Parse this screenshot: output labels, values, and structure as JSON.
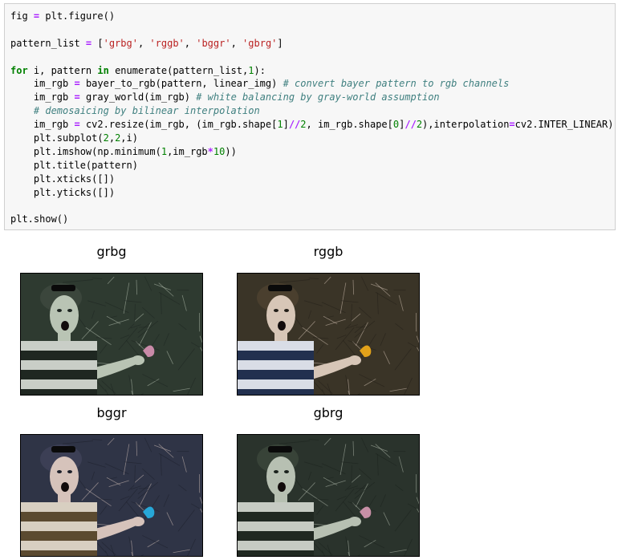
{
  "code_cell": {
    "lines": [
      [
        {
          "t": "plain",
          "v": "fig "
        },
        {
          "t": "op",
          "v": "="
        },
        {
          "t": "plain",
          "v": " plt.figure()"
        }
      ],
      [],
      [
        {
          "t": "plain",
          "v": "pattern_list "
        },
        {
          "t": "op",
          "v": "="
        },
        {
          "t": "plain",
          "v": " ["
        },
        {
          "t": "str",
          "v": "'grbg'"
        },
        {
          "t": "plain",
          "v": ", "
        },
        {
          "t": "str",
          "v": "'rggb'"
        },
        {
          "t": "plain",
          "v": ", "
        },
        {
          "t": "str",
          "v": "'bggr'"
        },
        {
          "t": "plain",
          "v": ", "
        },
        {
          "t": "str",
          "v": "'gbrg'"
        },
        {
          "t": "plain",
          "v": "]"
        }
      ],
      [],
      [
        {
          "t": "kw",
          "v": "for"
        },
        {
          "t": "plain",
          "v": " i, pattern "
        },
        {
          "t": "kw",
          "v": "in"
        },
        {
          "t": "plain",
          "v": " enumerate(pattern_list,"
        },
        {
          "t": "num",
          "v": "1"
        },
        {
          "t": "plain",
          "v": "):"
        }
      ],
      [
        {
          "t": "plain",
          "v": "    im_rgb "
        },
        {
          "t": "op",
          "v": "="
        },
        {
          "t": "plain",
          "v": " bayer_to_rgb(pattern, linear_img) "
        },
        {
          "t": "cm",
          "v": "# convert bayer pattern to rgb channels"
        }
      ],
      [
        {
          "t": "plain",
          "v": "    im_rgb "
        },
        {
          "t": "op",
          "v": "="
        },
        {
          "t": "plain",
          "v": " gray_world(im_rgb) "
        },
        {
          "t": "cm",
          "v": "# white balancing by gray-world assumption"
        }
      ],
      [
        {
          "t": "plain",
          "v": "    "
        },
        {
          "t": "cm",
          "v": "# demosaicing by bilinear interpolation"
        }
      ],
      [
        {
          "t": "plain",
          "v": "    im_rgb "
        },
        {
          "t": "op",
          "v": "="
        },
        {
          "t": "plain",
          "v": " cv2.resize(im_rgb, (im_rgb.shape["
        },
        {
          "t": "num",
          "v": "1"
        },
        {
          "t": "plain",
          "v": "]"
        },
        {
          "t": "op",
          "v": "//"
        },
        {
          "t": "num",
          "v": "2"
        },
        {
          "t": "plain",
          "v": ", im_rgb.shape["
        },
        {
          "t": "num",
          "v": "0"
        },
        {
          "t": "plain",
          "v": "]"
        },
        {
          "t": "op",
          "v": "//"
        },
        {
          "t": "num",
          "v": "2"
        },
        {
          "t": "plain",
          "v": "),interpolation"
        },
        {
          "t": "op",
          "v": "="
        },
        {
          "t": "plain",
          "v": "cv2.INTER_LINEAR)"
        }
      ],
      [
        {
          "t": "plain",
          "v": "    plt.subplot("
        },
        {
          "t": "num",
          "v": "2"
        },
        {
          "t": "plain",
          "v": ","
        },
        {
          "t": "num",
          "v": "2"
        },
        {
          "t": "plain",
          "v": ",i)"
        }
      ],
      [
        {
          "t": "plain",
          "v": "    plt.imshow(np.minimum("
        },
        {
          "t": "num",
          "v": "1"
        },
        {
          "t": "plain",
          "v": ",im_rgb"
        },
        {
          "t": "op",
          "v": "*"
        },
        {
          "t": "num",
          "v": "10"
        },
        {
          "t": "plain",
          "v": "))"
        }
      ],
      [
        {
          "t": "plain",
          "v": "    plt.title(pattern)"
        }
      ],
      [
        {
          "t": "plain",
          "v": "    plt.xticks([])"
        }
      ],
      [
        {
          "t": "plain",
          "v": "    plt.yticks([])"
        }
      ],
      [],
      [
        {
          "t": "plain",
          "v": "plt.show()"
        }
      ]
    ]
  },
  "figure": {
    "subplots": [
      {
        "title": "grbg",
        "tint": {
          "bg": "#2e3a30",
          "skin": "#b9c4b4",
          "shadow": "#1c2420",
          "stripe_light": "#c9cec7",
          "stripe_dark": "#1f2721",
          "slug": "#c98aa8",
          "hair": "#3b463c"
        }
      },
      {
        "title": "rggb",
        "tint": {
          "bg": "#3a3427",
          "skin": "#d7c6b7",
          "shadow": "#221e18",
          "stripe_light": "#d9dde6",
          "stripe_dark": "#22304f",
          "slug": "#e2a21a",
          "hair": "#4a3f2e"
        }
      },
      {
        "title": "bggr",
        "tint": {
          "bg": "#2f3446",
          "skin": "#d6c3bb",
          "shadow": "#1c1f2a",
          "stripe_light": "#d8cfc1",
          "stripe_dark": "#5b4a30",
          "slug": "#27a7d7",
          "hair": "#3c3f55"
        }
      },
      {
        "title": "gbrg",
        "tint": {
          "bg": "#2a332c",
          "skin": "#b7c0b2",
          "shadow": "#1a211c",
          "stripe_light": "#c6cbc3",
          "stripe_dark": "#202821",
          "slug": "#c78fa6",
          "hair": "#384338"
        }
      }
    ]
  }
}
